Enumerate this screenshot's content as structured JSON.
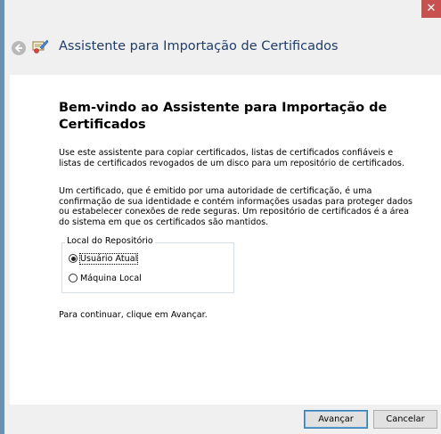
{
  "window": {
    "title": "Assistente para Importação de Certificados",
    "close_symbol": "✕"
  },
  "content": {
    "heading": "Bem-vindo ao Assistente para Importação de Certificados",
    "intro": "Use este assistente para copiar certificados, listas de certificados confiáveis e listas de certificados revogados de um disco para um repositório de certificados.",
    "description": "Um certificado, que é emitido por uma autoridade de certificação, é uma confirmação de sua identidade e contém informações usadas para proteger dados ou estabelecer conexões de rede seguras. Um repositório de certificados é a área do sistema em que os certificados são mantidos.",
    "store_location": {
      "legend": "Local do Repositório",
      "options": [
        {
          "label": "Usuário Atual",
          "selected": true
        },
        {
          "label": "Máquina Local",
          "selected": false
        }
      ]
    },
    "continue_text": "Para continuar, clique em Avançar."
  },
  "buttons": {
    "next": "Avançar",
    "cancel": "Cancelar"
  },
  "icons": {
    "back": "back-arrow-icon",
    "wizard": "certificate-icon",
    "close": "close-icon"
  },
  "colors": {
    "close_button": "#c75050",
    "title_text": "#1e3d6b",
    "primary_button_border": "#3c7fb1"
  }
}
